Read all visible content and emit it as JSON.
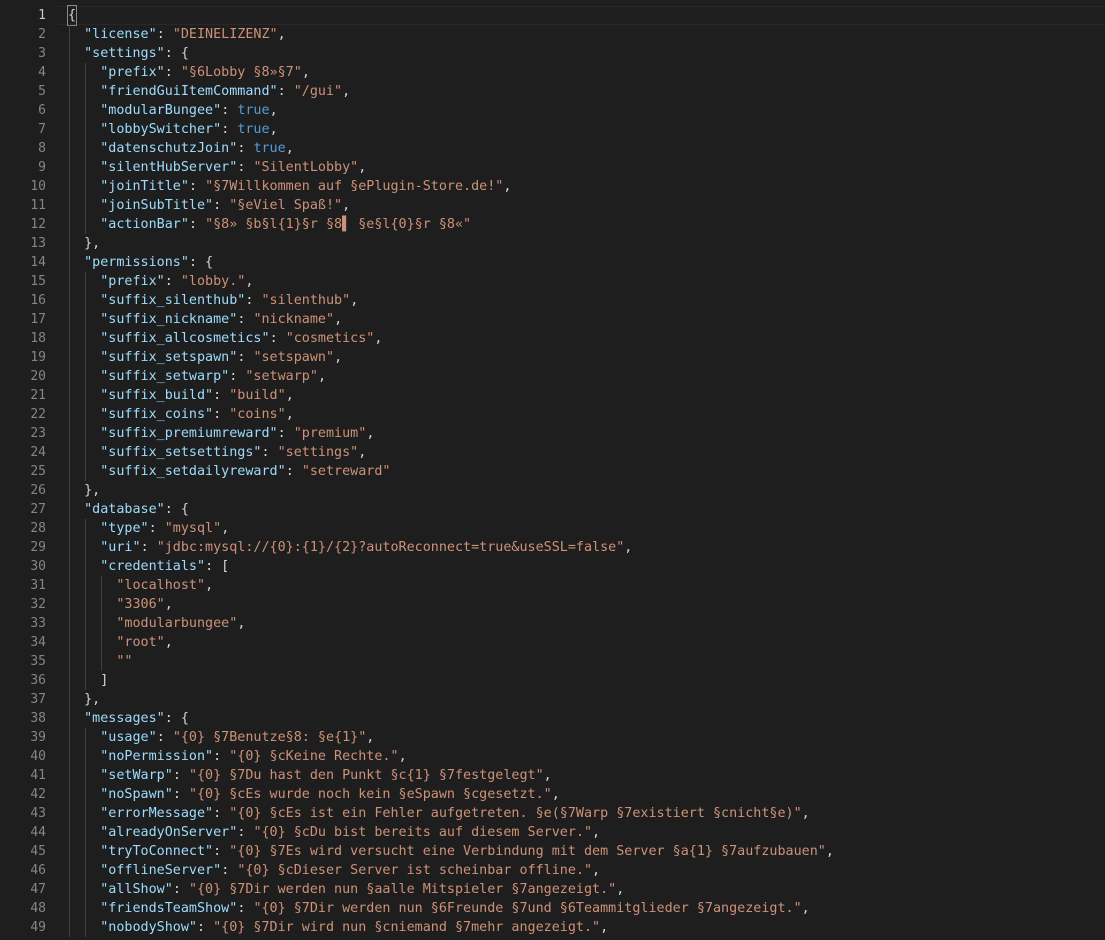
{
  "editor": {
    "top_ghost": "",
    "colors": {
      "background": "#1e1e1e",
      "key": "#9cdcfe",
      "string": "#ce9178",
      "boolean": "#569cd6",
      "punctuation": "#d4d4d4",
      "line_number": "#858585"
    },
    "lines": [
      [
        [
          "p",
          "{"
        ]
      ],
      [
        [
          "k",
          "\"license\""
        ],
        [
          "p",
          ": "
        ],
        [
          "s",
          "\"DEINELIZENZ\""
        ],
        [
          "p",
          ","
        ]
      ],
      [
        [
          "k",
          "\"settings\""
        ],
        [
          "p",
          ": {"
        ]
      ],
      [
        [
          "k",
          "\"prefix\""
        ],
        [
          "p",
          ": "
        ],
        [
          "s",
          "\"§6Lobby §8»§7\""
        ],
        [
          "p",
          ","
        ]
      ],
      [
        [
          "k",
          "\"friendGuiItemCommand\""
        ],
        [
          "p",
          ": "
        ],
        [
          "s",
          "\"/gui\""
        ],
        [
          "p",
          ","
        ]
      ],
      [
        [
          "k",
          "\"modularBungee\""
        ],
        [
          "p",
          ": "
        ],
        [
          "b",
          "true"
        ],
        [
          "p",
          ","
        ]
      ],
      [
        [
          "k",
          "\"lobbySwitcher\""
        ],
        [
          "p",
          ": "
        ],
        [
          "b",
          "true"
        ],
        [
          "p",
          ","
        ]
      ],
      [
        [
          "k",
          "\"datenschutzJoin\""
        ],
        [
          "p",
          ": "
        ],
        [
          "b",
          "true"
        ],
        [
          "p",
          ","
        ]
      ],
      [
        [
          "k",
          "\"silentHubServer\""
        ],
        [
          "p",
          ": "
        ],
        [
          "s",
          "\"SilentLobby\""
        ],
        [
          "p",
          ","
        ]
      ],
      [
        [
          "k",
          "\"joinTitle\""
        ],
        [
          "p",
          ": "
        ],
        [
          "s",
          "\"§7Willkommen auf §ePlugin-Store.de!\""
        ],
        [
          "p",
          ","
        ]
      ],
      [
        [
          "k",
          "\"joinSubTitle\""
        ],
        [
          "p",
          ": "
        ],
        [
          "s",
          "\"§eViel Spaß!\""
        ],
        [
          "p",
          ","
        ]
      ],
      [
        [
          "k",
          "\"actionBar\""
        ],
        [
          "p",
          ": "
        ],
        [
          "s",
          "\"§8» §b§l{1}§r §8▌ §e§l{0}§r §8«\""
        ]
      ],
      [
        [
          "p",
          "},"
        ]
      ],
      [
        [
          "k",
          "\"permissions\""
        ],
        [
          "p",
          ": {"
        ]
      ],
      [
        [
          "k",
          "\"prefix\""
        ],
        [
          "p",
          ": "
        ],
        [
          "s",
          "\"lobby.\""
        ],
        [
          "p",
          ","
        ]
      ],
      [
        [
          "k",
          "\"suffix_silenthub\""
        ],
        [
          "p",
          ": "
        ],
        [
          "s",
          "\"silenthub\""
        ],
        [
          "p",
          ","
        ]
      ],
      [
        [
          "k",
          "\"suffix_nickname\""
        ],
        [
          "p",
          ": "
        ],
        [
          "s",
          "\"nickname\""
        ],
        [
          "p",
          ","
        ]
      ],
      [
        [
          "k",
          "\"suffix_allcosmetics\""
        ],
        [
          "p",
          ": "
        ],
        [
          "s",
          "\"cosmetics\""
        ],
        [
          "p",
          ","
        ]
      ],
      [
        [
          "k",
          "\"suffix_setspawn\""
        ],
        [
          "p",
          ": "
        ],
        [
          "s",
          "\"setspawn\""
        ],
        [
          "p",
          ","
        ]
      ],
      [
        [
          "k",
          "\"suffix_setwarp\""
        ],
        [
          "p",
          ": "
        ],
        [
          "s",
          "\"setwarp\""
        ],
        [
          "p",
          ","
        ]
      ],
      [
        [
          "k",
          "\"suffix_build\""
        ],
        [
          "p",
          ": "
        ],
        [
          "s",
          "\"build\""
        ],
        [
          "p",
          ","
        ]
      ],
      [
        [
          "k",
          "\"suffix_coins\""
        ],
        [
          "p",
          ": "
        ],
        [
          "s",
          "\"coins\""
        ],
        [
          "p",
          ","
        ]
      ],
      [
        [
          "k",
          "\"suffix_premiumreward\""
        ],
        [
          "p",
          ": "
        ],
        [
          "s",
          "\"premium\""
        ],
        [
          "p",
          ","
        ]
      ],
      [
        [
          "k",
          "\"suffix_setsettings\""
        ],
        [
          "p",
          ": "
        ],
        [
          "s",
          "\"settings\""
        ],
        [
          "p",
          ","
        ]
      ],
      [
        [
          "k",
          "\"suffix_setdailyreward\""
        ],
        [
          "p",
          ": "
        ],
        [
          "s",
          "\"setreward\""
        ]
      ],
      [
        [
          "p",
          "},"
        ]
      ],
      [
        [
          "k",
          "\"database\""
        ],
        [
          "p",
          ": {"
        ]
      ],
      [
        [
          "k",
          "\"type\""
        ],
        [
          "p",
          ": "
        ],
        [
          "s",
          "\"mysql\""
        ],
        [
          "p",
          ","
        ]
      ],
      [
        [
          "k",
          "\"uri\""
        ],
        [
          "p",
          ": "
        ],
        [
          "s",
          "\"jdbc:mysql://{0}:{1}/{2}?autoReconnect=true&useSSL=false\""
        ],
        [
          "p",
          ","
        ]
      ],
      [
        [
          "k",
          "\"credentials\""
        ],
        [
          "p",
          ": ["
        ]
      ],
      [
        [
          "s",
          "\"localhost\""
        ],
        [
          "p",
          ","
        ]
      ],
      [
        [
          "s",
          "\"3306\""
        ],
        [
          "p",
          ","
        ]
      ],
      [
        [
          "s",
          "\"modularbungee\""
        ],
        [
          "p",
          ","
        ]
      ],
      [
        [
          "s",
          "\"root\""
        ],
        [
          "p",
          ","
        ]
      ],
      [
        [
          "s",
          "\"\""
        ]
      ],
      [
        [
          "p",
          "]"
        ]
      ],
      [
        [
          "p",
          "},"
        ]
      ],
      [
        [
          "k",
          "\"messages\""
        ],
        [
          "p",
          ": {"
        ]
      ],
      [
        [
          "k",
          "\"usage\""
        ],
        [
          "p",
          ": "
        ],
        [
          "s",
          "\"{0} §7Benutze§8: §e{1}\""
        ],
        [
          "p",
          ","
        ]
      ],
      [
        [
          "k",
          "\"noPermission\""
        ],
        [
          "p",
          ": "
        ],
        [
          "s",
          "\"{0} §cKeine Rechte.\""
        ],
        [
          "p",
          ","
        ]
      ],
      [
        [
          "k",
          "\"setWarp\""
        ],
        [
          "p",
          ": "
        ],
        [
          "s",
          "\"{0} §7Du hast den Punkt §c{1} §7festgelegt\""
        ],
        [
          "p",
          ","
        ]
      ],
      [
        [
          "k",
          "\"noSpawn\""
        ],
        [
          "p",
          ": "
        ],
        [
          "s",
          "\"{0} §cEs wurde noch kein §eSpawn §cgesetzt.\""
        ],
        [
          "p",
          ","
        ]
      ],
      [
        [
          "k",
          "\"errorMessage\""
        ],
        [
          "p",
          ": "
        ],
        [
          "s",
          "\"{0} §cEs ist ein Fehler aufgetreten. §e(§7Warp §7existiert §cnicht§e)\""
        ],
        [
          "p",
          ","
        ]
      ],
      [
        [
          "k",
          "\"alreadyOnServer\""
        ],
        [
          "p",
          ": "
        ],
        [
          "s",
          "\"{0} §cDu bist bereits auf diesem Server.\""
        ],
        [
          "p",
          ","
        ]
      ],
      [
        [
          "k",
          "\"tryToConnect\""
        ],
        [
          "p",
          ": "
        ],
        [
          "s",
          "\"{0} §7Es wird versucht eine Verbindung mit dem Server §a{1} §7aufzubauen\""
        ],
        [
          "p",
          ","
        ]
      ],
      [
        [
          "k",
          "\"offlineServer\""
        ],
        [
          "p",
          ": "
        ],
        [
          "s",
          "\"{0} §cDieser Server ist scheinbar offline.\""
        ],
        [
          "p",
          ","
        ]
      ],
      [
        [
          "k",
          "\"allShow\""
        ],
        [
          "p",
          ": "
        ],
        [
          "s",
          "\"{0} §7Dir werden nun §aalle Mitspieler §7angezeigt.\""
        ],
        [
          "p",
          ","
        ]
      ],
      [
        [
          "k",
          "\"friendsTeamShow\""
        ],
        [
          "p",
          ": "
        ],
        [
          "s",
          "\"{0} §7Dir werden nun §6Freunde §7und §6Teammitglieder §7angezeigt.\""
        ],
        [
          "p",
          ","
        ]
      ],
      [
        [
          "k",
          "\"nobodyShow\""
        ],
        [
          "p",
          ": "
        ],
        [
          "s",
          "\"{0} §7Dir wird nun §cniemand §7mehr angezeigt.\""
        ],
        [
          "p",
          ","
        ]
      ]
    ],
    "line_numbers": [
      "1",
      "2",
      "3",
      "4",
      "5",
      "6",
      "7",
      "8",
      "9",
      "10",
      "11",
      "12",
      "13",
      "14",
      "15",
      "16",
      "17",
      "18",
      "19",
      "20",
      "21",
      "22",
      "23",
      "24",
      "25",
      "26",
      "27",
      "28",
      "29",
      "30",
      "31",
      "32",
      "33",
      "34",
      "35",
      "36",
      "37",
      "38",
      "39",
      "40",
      "41",
      "42",
      "43",
      "44",
      "45",
      "46",
      "47",
      "48",
      "49"
    ]
  }
}
